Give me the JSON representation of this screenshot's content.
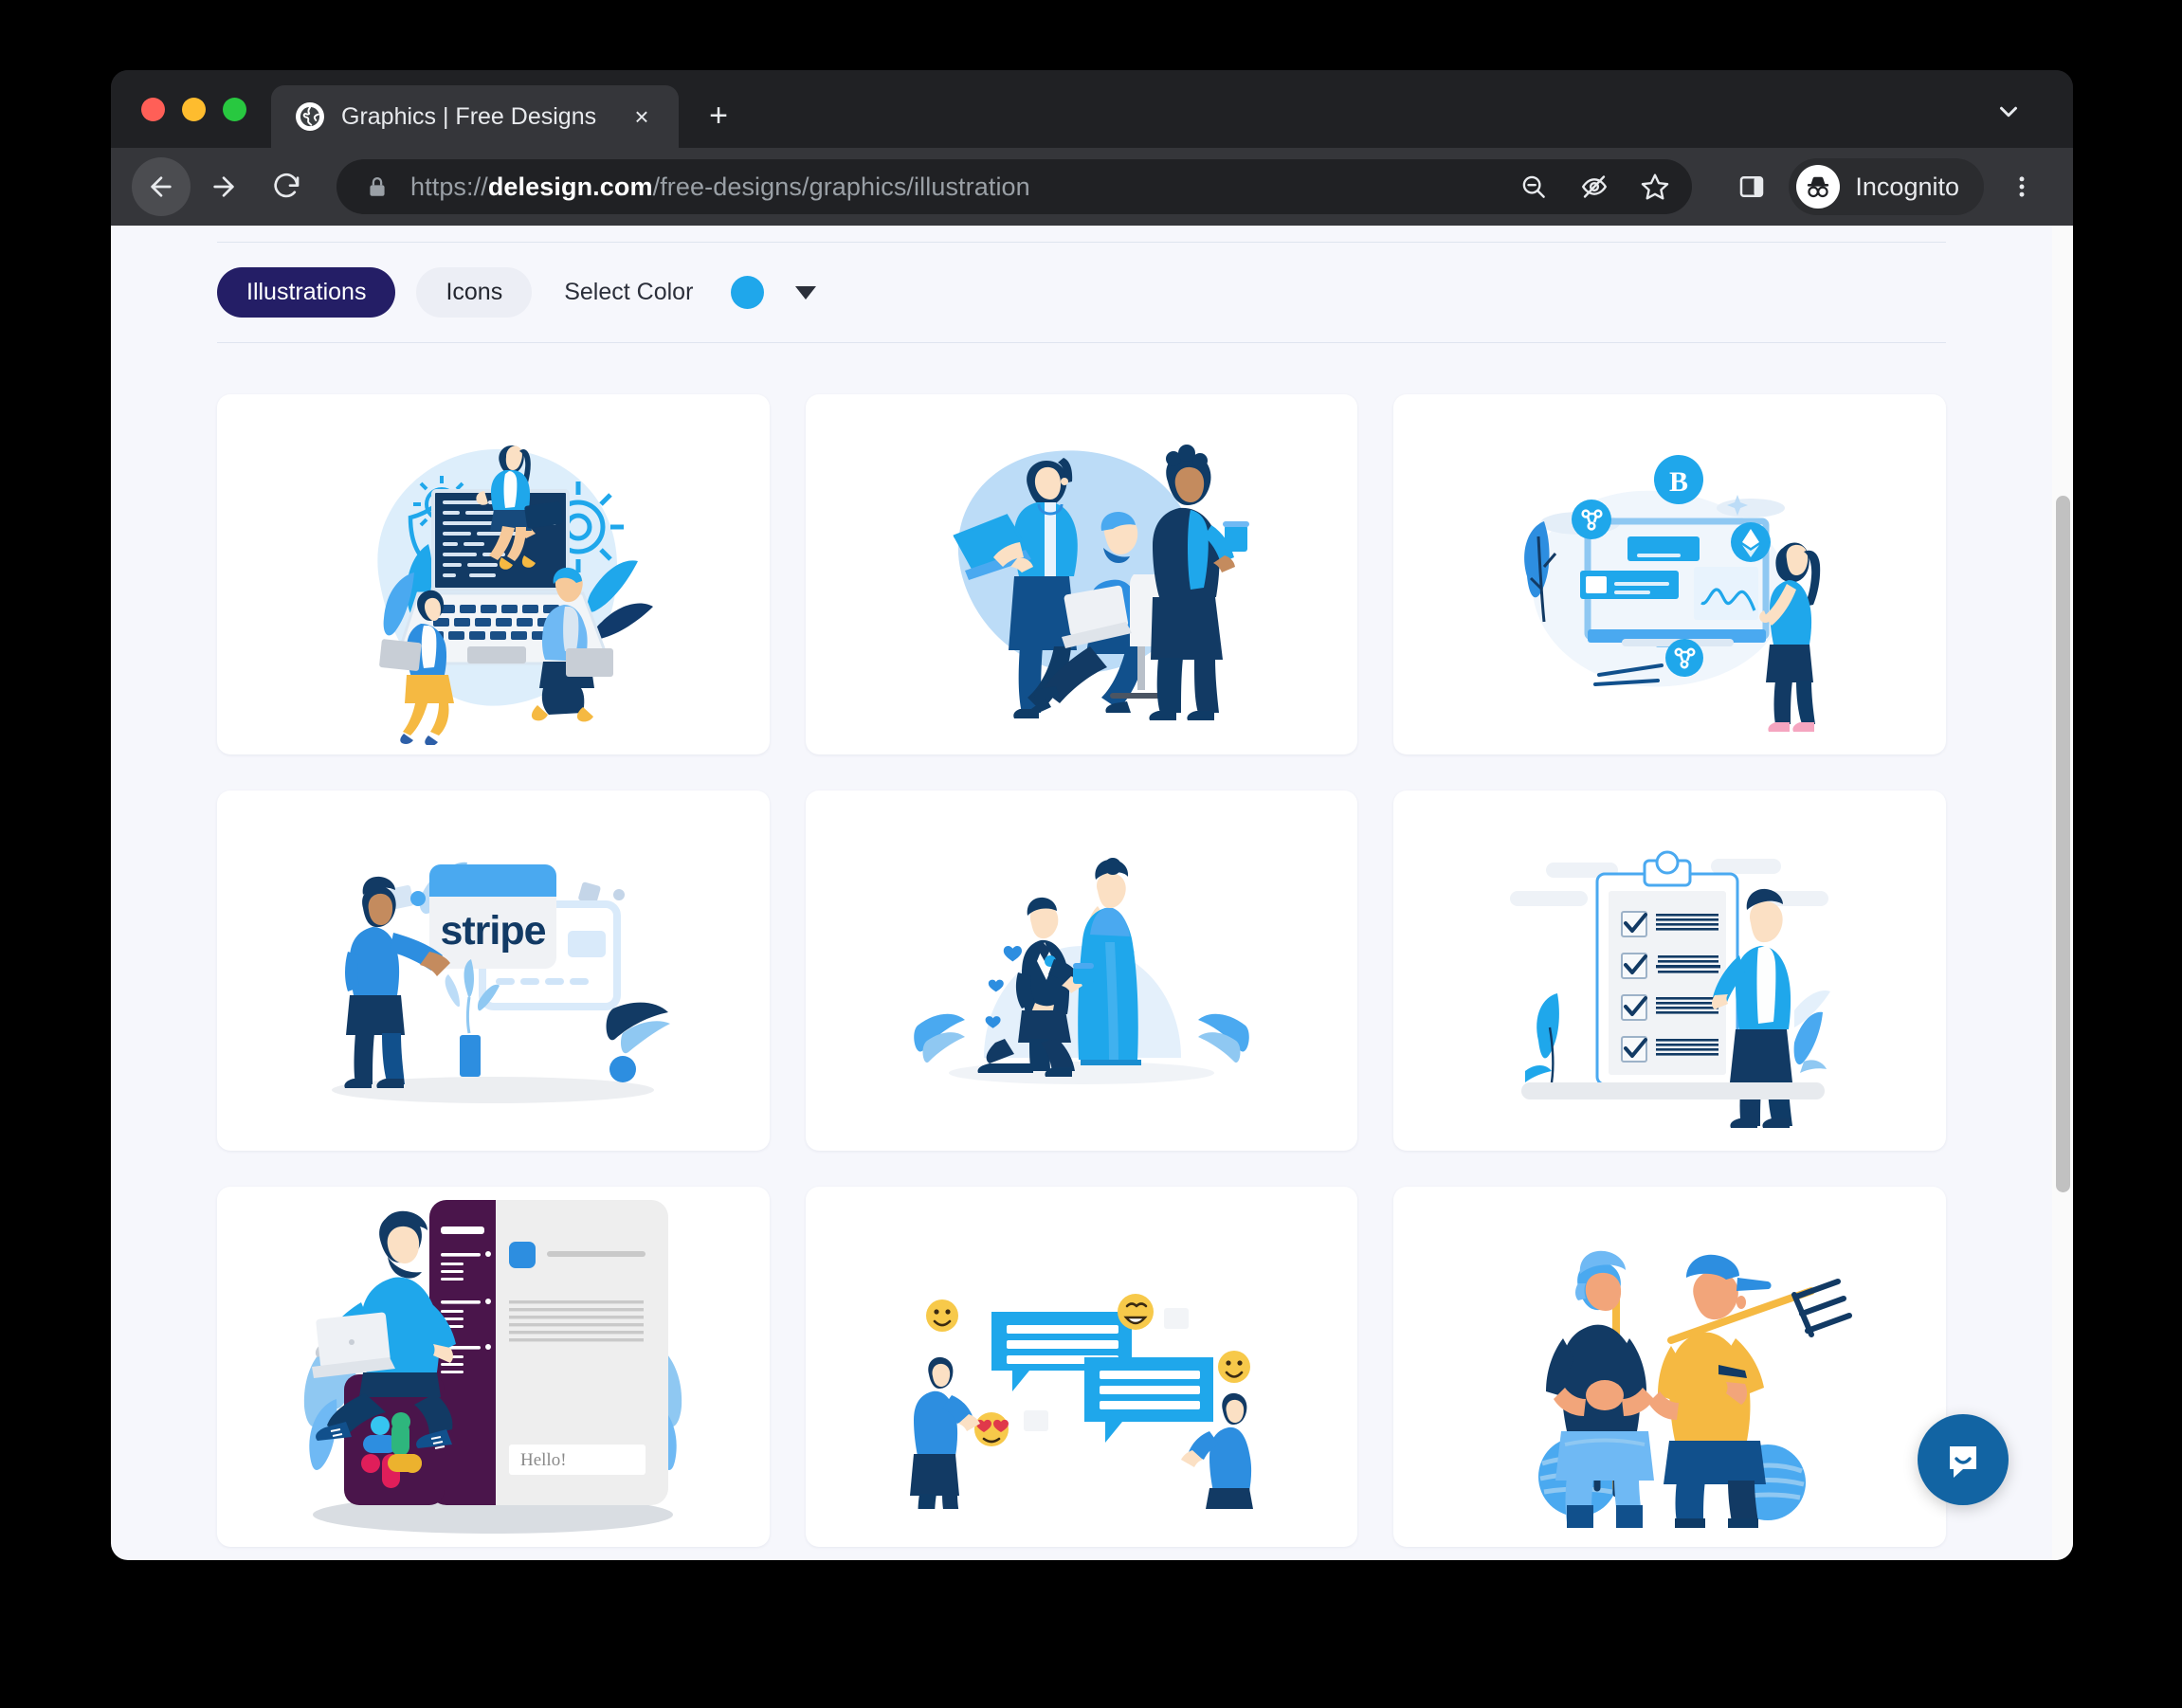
{
  "browser": {
    "traffic_lights": {
      "close_color": "#ff5f57",
      "minimize_color": "#febc2e",
      "maximize_color": "#28c840"
    },
    "tab": {
      "title": "Graphics | Free Designs",
      "close_label": "×",
      "favicon_name": "globe-favicon"
    },
    "new_tab_label": "+",
    "tab_list_chevron_name": "chevron-down-icon",
    "toolbar": {
      "back_label": "←",
      "forward_label": "→",
      "reload_label": "↻",
      "url_scheme": "https://",
      "url_domain": "delesign.com",
      "url_path": "/free-designs/graphics/illustration",
      "zoom_out_icon": "zoom-out-icon",
      "hidden_eye_icon": "eye-slash-icon",
      "bookmark_icon": "star-icon",
      "side_panel_icon": "side-panel-icon",
      "profile_label": "Incognito",
      "menu_label": "⋮"
    }
  },
  "page": {
    "filters": {
      "tab_illustrations": "Illustrations",
      "tab_icons": "Icons",
      "select_color_label": "Select Color",
      "selected_color": "#1fa7eb",
      "caret": "▼"
    },
    "cards": [
      {
        "name": "programming-team-illustration",
        "alt": "Developers coding around a large laptop"
      },
      {
        "name": "office-collaboration-illustration",
        "alt": "Three coworkers with laptops and coffee"
      },
      {
        "name": "cryptocurrency-dashboard-illustration",
        "alt": "Woman at crypto dashboard with Bitcoin, Ripple and Ethereum coins"
      },
      {
        "name": "stripe-payment-illustration",
        "alt": "Man presenting a Stripe payment card"
      },
      {
        "name": "marriage-proposal-illustration",
        "alt": "Man proposing to woman in blue gown with hearts"
      },
      {
        "name": "checklist-clipboard-illustration",
        "alt": "Man beside a large clipboard with four checked items"
      },
      {
        "name": "slack-workspace-illustration",
        "alt": "Man on laptop seated on a Slack app window"
      },
      {
        "name": "chat-messaging-illustration",
        "alt": "Two people chatting in speech bubbles with emoji"
      },
      {
        "name": "farmers-illustration",
        "alt": "Two farmers holding pitchforks"
      }
    ],
    "slack_card": {
      "message_placeholder": "Hello!"
    },
    "stripe_card": {
      "brand_text": "stripe"
    },
    "intercom": {
      "launcher_name": "intercom-chat-launcher",
      "color": "#1264a3"
    },
    "scrollbar": {
      "thumb_color": "#c1c1c1"
    }
  }
}
